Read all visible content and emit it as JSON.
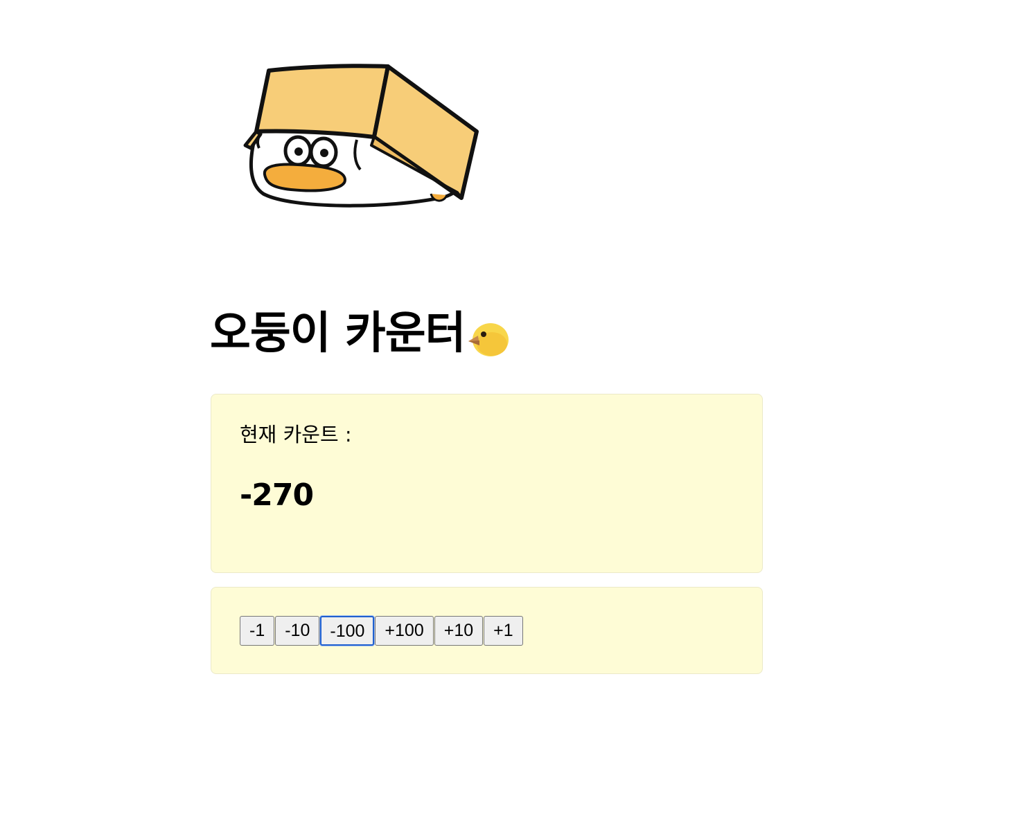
{
  "title": {
    "text": "오둥이 카운터",
    "emoji_icon": "chick-icon"
  },
  "mascot": {
    "icon": "duck-in-box-icon",
    "box_color": "#f7cd78",
    "beak_color": "#f4ad3d"
  },
  "counter": {
    "label": "현재 카운트 :",
    "value": "-270"
  },
  "buttons": [
    {
      "label": "-1",
      "name": "minus-1-button"
    },
    {
      "label": "-10",
      "name": "minus-10-button"
    },
    {
      "label": "-100",
      "name": "minus-100-button",
      "focused": true
    },
    {
      "label": "+100",
      "name": "plus-100-button"
    },
    {
      "label": "+10",
      "name": "plus-10-button"
    },
    {
      "label": "+1",
      "name": "plus-1-button"
    }
  ],
  "colors": {
    "panel_background": "#fefcd6",
    "focus_ring": "#1f5fcf"
  }
}
